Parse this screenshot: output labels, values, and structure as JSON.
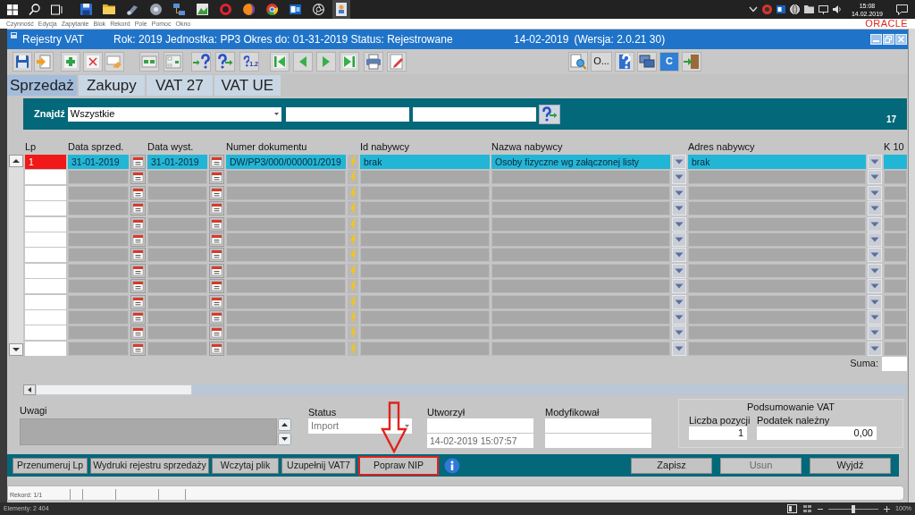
{
  "taskbar": {
    "clock_time": "15:08",
    "clock_date": "14.02.2019"
  },
  "menu_bar": {
    "items": [
      "Czynność",
      "Edycja",
      "Zapytanie",
      "Blok",
      "Rekord",
      "Pole",
      "Pomoc",
      "Okno"
    ],
    "logo": "ORACLE"
  },
  "window": {
    "title": "Rejestry VAT",
    "context": "Rok: 2019 Jednostka: PP3 Okres do: 01-31-2019 Status: Rejestrowane",
    "date": "14-02-2019",
    "version": "(Wersja: 2.0.21 30)"
  },
  "toolbar": {
    "query_count_label": "1.2",
    "options_button": "O...",
    "tile_button": "C"
  },
  "tabs": [
    {
      "label": "Sprzedaż",
      "selected": true
    },
    {
      "label": "Zakupy",
      "selected": false
    },
    {
      "label": "VAT 27",
      "selected": false
    },
    {
      "label": "VAT UE",
      "selected": false
    }
  ],
  "search": {
    "label": "Znajdź",
    "filter": "Wszystkie",
    "count": "17"
  },
  "table": {
    "columns": [
      "Lp",
      "Data sprzed.",
      "Data wyst.",
      "Numer dokumentu",
      "Id nabywcy",
      "Nazwa nabywcy",
      "Adres nabywcy",
      "K 10"
    ],
    "rows": [
      {
        "selected": true,
        "lp": "1",
        "sale_date": "31-01-2019",
        "issue_date": "31-01-2019",
        "document_number": "DW/PP3/000/000001/2019",
        "buyer_id": "brak",
        "buyer_name": "Osoby fizyczne wg załączonej listy",
        "buyer_address": "brak"
      },
      {
        "selected": false
      },
      {
        "selected": false
      },
      {
        "selected": false
      },
      {
        "selected": false
      },
      {
        "selected": false
      },
      {
        "selected": false
      },
      {
        "selected": false
      },
      {
        "selected": false
      },
      {
        "selected": false
      },
      {
        "selected": false
      },
      {
        "selected": false
      },
      {
        "selected": false
      }
    ],
    "sum_label": "Suma:"
  },
  "details": {
    "notes_label": "Uwagi",
    "status_label": "Status",
    "status_value": "Import",
    "created_label": "Utworzył",
    "created_value": "14-02-2019 15:07:57",
    "modified_label": "Modyfikował"
  },
  "vat_summary": {
    "title": "Podsumowanie VAT",
    "count_label": "Liczba pozycji",
    "count_value": "1",
    "tax_label": "Podatek należny",
    "tax_value": "0,00"
  },
  "action_buttons": [
    {
      "label": "Przenumeruj Lp",
      "highlighted": false
    },
    {
      "label": "Wydruki rejestru sprzedaży",
      "highlighted": false
    },
    {
      "label": "Wczytaj plik",
      "highlighted": false
    },
    {
      "label": "Uzupełnij VAT7",
      "highlighted": false
    },
    {
      "label": "Popraw NIP",
      "highlighted": true
    }
  ],
  "form_buttons": [
    {
      "label": "Zapisz",
      "disabled": false
    },
    {
      "label": "Usun",
      "disabled": true
    },
    {
      "label": "Wyjdź",
      "disabled": false
    }
  ],
  "status_bar": {
    "record": "Rekord: 1/1"
  },
  "explorer_status": {
    "items_count": "Elementy: 2 404",
    "zoom_slider": {
      "level": 0.5
    },
    "zoom": "100%"
  }
}
